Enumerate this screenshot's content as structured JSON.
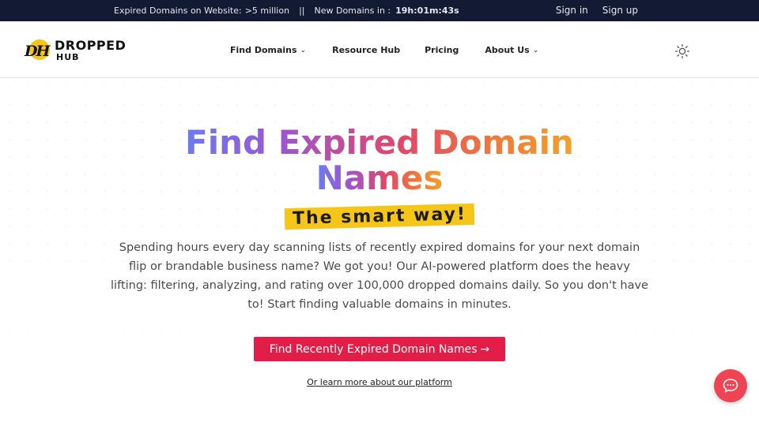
{
  "topbar": {
    "expired_label": "Expired Domains on Website:",
    "expired_value": ">5 million",
    "separator": "||",
    "new_label": "New Domains in :",
    "countdown": "19h:01m:43s",
    "sign_in": "Sign in",
    "sign_up": "Sign up"
  },
  "logo": {
    "mark": "DH",
    "word1": "DROPPED",
    "word2": "HUB"
  },
  "nav": {
    "items": [
      {
        "label": "Find Domains",
        "dropdown": true
      },
      {
        "label": "Resource Hub",
        "dropdown": false
      },
      {
        "label": "Pricing",
        "dropdown": false
      },
      {
        "label": "About Us",
        "dropdown": true
      }
    ],
    "theme_icon": "sun-icon"
  },
  "hero": {
    "title_line1": "Find Expired Domain",
    "title_line2": "Names",
    "tagline": "The smart way!",
    "description": "Spending hours every day scanning lists of recently expired domains for your next domain flip or brandable business name? We got you! Our AI-powered platform does the heavy lifting: filtering, analyzing, and rating over 100,000 dropped domains daily. So you don't have to! Start finding valuable domains in minutes.",
    "cta_label": "Find Recently Expired Domain Names",
    "cta_arrow": "→",
    "learn_more": "Or learn more about our platform"
  },
  "colors": {
    "topbar_bg": "#131a33",
    "accent_red": "#e11d48",
    "highlight_yellow": "#f5c518",
    "chat_bubble": "#ef4454"
  },
  "chat": {
    "icon": "chat-bubble-icon"
  }
}
